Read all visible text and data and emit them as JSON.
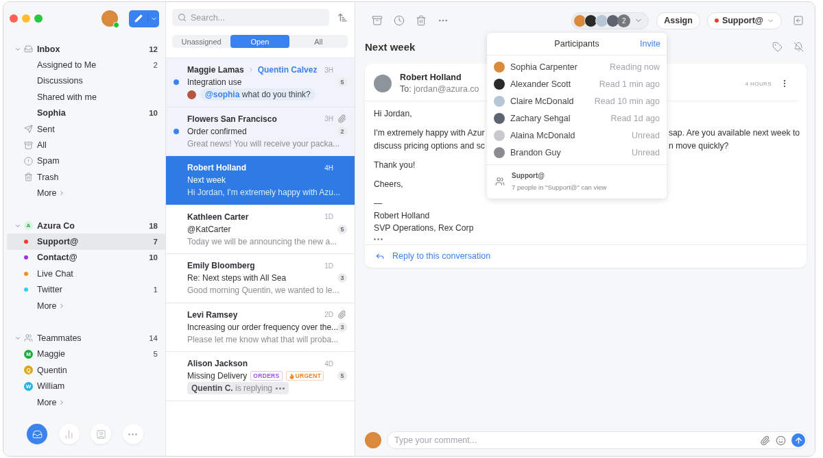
{
  "sidebar": {
    "user": {
      "online": true
    },
    "sections": [
      {
        "title": "Inbox",
        "count": "12",
        "expanded": true,
        "unread": true,
        "badge": {
          "kind": "inbox"
        },
        "items": [
          {
            "kind": "plain",
            "label": "Assigned to Me",
            "count": "2",
            "unread": false,
            "selected": false
          },
          {
            "kind": "plain",
            "label": "Discussions",
            "unread": false,
            "selected": false
          },
          {
            "kind": "plain",
            "label": "Shared with me",
            "unread": false,
            "selected": false
          },
          {
            "kind": "plain",
            "label": "Sophia",
            "count": "10",
            "unread": true,
            "selected": false
          },
          {
            "kind": "sent",
            "label": "Sent",
            "unread": false,
            "selected": false
          },
          {
            "kind": "archive",
            "label": "All",
            "unread": false,
            "selected": false
          },
          {
            "kind": "spam",
            "label": "Spam",
            "unread": false,
            "selected": false
          },
          {
            "kind": "trash",
            "label": "Trash",
            "unread": false,
            "selected": false
          },
          {
            "kind": "more",
            "label": "More",
            "unread": false,
            "selected": false
          }
        ]
      },
      {
        "title": "Azura Co",
        "count": "18",
        "expanded": true,
        "unread": true,
        "badge": {
          "kind": "letter",
          "letter": "A"
        },
        "items": [
          {
            "kind": "dot",
            "color": "#f23b2e",
            "label": "Support@",
            "count": "7",
            "unread": true,
            "selected": true
          },
          {
            "kind": "dot",
            "color": "#9b30f0",
            "label": "Contact@",
            "count": "10",
            "unread": true,
            "selected": false
          },
          {
            "kind": "dot",
            "color": "#fb8c1e",
            "label": "Live Chat",
            "unread": false,
            "selected": false
          },
          {
            "kind": "dot",
            "color": "#2ad0f5",
            "label": "Twitter",
            "count": "1",
            "unread": false,
            "selected": false
          },
          {
            "kind": "more",
            "label": "More",
            "unread": false,
            "selected": false
          }
        ]
      },
      {
        "title": "Teammates",
        "count": "14",
        "expanded": true,
        "unread": false,
        "badge": {
          "kind": "people"
        },
        "items": [
          {
            "kind": "letter",
            "letter": "M",
            "color": "#1eae3f",
            "label": "Maggie",
            "count": "5",
            "unread": false,
            "selected": false
          },
          {
            "kind": "letter",
            "letter": "Q",
            "color": "#dca818",
            "label": "Quentin",
            "unread": false,
            "selected": false
          },
          {
            "kind": "letter",
            "letter": "W",
            "color": "#22b2e4",
            "label": "William",
            "unread": false,
            "selected": false
          },
          {
            "kind": "more",
            "label": "More",
            "unread": false,
            "selected": false
          }
        ]
      }
    ],
    "nav": [
      {
        "kind": "inbox",
        "selected": true
      },
      {
        "kind": "analytics",
        "selected": false
      },
      {
        "kind": "contacts",
        "selected": false
      },
      {
        "kind": "more",
        "selected": false
      }
    ]
  },
  "list": {
    "search": {
      "placeholder": "Search..."
    },
    "tabs": [
      {
        "label": "Unassigned",
        "selected": false
      },
      {
        "label": "Open",
        "selected": true
      },
      {
        "label": "All",
        "selected": false
      }
    ],
    "conversations": [
      {
        "from": "Maggie Lamas",
        "assignee": "Quentin Calvez",
        "time": "3H",
        "subject": "Integration use",
        "count": "5",
        "unread": true,
        "selected": false,
        "attachment": false,
        "comment": {
          "mention": "@sophia",
          "text": "what do you think?"
        }
      },
      {
        "from": "Flowers San Francisco",
        "time": "3H",
        "subject": "Order confirmed",
        "preview": "Great news! You will receive your packa...",
        "count": "2",
        "unread": true,
        "selected": false,
        "attachment": true
      },
      {
        "from": "Robert Holland",
        "time": "4H",
        "subject": "Next week",
        "preview": "Hi Jordan, I'm extremely happy with Azu...",
        "unread": false,
        "selected": true,
        "attachment": false
      },
      {
        "from": "Kathleen Carter",
        "time": "1D",
        "subject": "@KatCarter",
        "preview": "Today we will be announcing the new a...",
        "count": "5",
        "unread": false,
        "selected": false,
        "attachment": false
      },
      {
        "from": "Emily Bloomberg",
        "time": "1D",
        "subject": "Re: Next steps with All Sea",
        "preview": "Good morning Quentin, we wanted to le...",
        "count": "3",
        "unread": false,
        "selected": false,
        "attachment": false
      },
      {
        "from": "Levi Ramsey",
        "time": "2D",
        "subject": "Increasing our order frequency over the...",
        "preview": "Please let me know what that will proba...",
        "count": "3",
        "unread": false,
        "selected": false,
        "attachment": true
      },
      {
        "from": "Alison Jackson",
        "time": "4D",
        "subject": "Missing Delivery",
        "count": "5",
        "unread": false,
        "selected": false,
        "attachment": false,
        "tags": [
          {
            "kind": "plain",
            "label": "ORDERS",
            "color": "#a24ff0"
          },
          {
            "kind": "fire",
            "label": "URGENT",
            "color": "#f5821f"
          }
        ],
        "typing": {
          "who": "Quentin C.",
          "text": "is replying"
        }
      }
    ]
  },
  "main": {
    "toolbar": {
      "participants_extra": "2",
      "assign": "Assign",
      "inbox": {
        "label": "Support@",
        "color": "#f23b2e"
      }
    },
    "title": "Next week",
    "message": {
      "sender": "Robert Holland",
      "to_label": "To:",
      "to": "jordan@azura.co",
      "time": "4 HOURS",
      "body": [
        {
          "kind": "text",
          "text": "Hi Jordan,"
        },
        {
          "kind": "split",
          "lines": [
            {
              "left": "I'm extremely happy with Azur",
              "right": "sap. Are you available next week to"
            },
            {
              "left": "discuss pricing options and sc",
              "right": "n move quickly?"
            }
          ]
        },
        {
          "kind": "text",
          "text": "Thank you!"
        },
        {
          "kind": "text",
          "text": "Cheers,"
        },
        {
          "kind": "signature",
          "lines": [
            "—",
            "Robert Holland",
            "SVP Operations, Rex Corp"
          ]
        },
        {
          "kind": "more"
        }
      ],
      "reply": "Reply to this conversation"
    },
    "composer": {
      "placeholder": "Type your comment..."
    },
    "popup": {
      "title": "Participants",
      "action": "Invite",
      "people": [
        {
          "name": "Sophia Carpenter",
          "status": "Reading now"
        },
        {
          "name": "Alexander Scott",
          "status": "Read 1 min ago"
        },
        {
          "name": "Claire McDonald",
          "status": "Read 10 min ago"
        },
        {
          "name": "Zachary Sehgal",
          "status": "Read 1d ago"
        },
        {
          "name": "Alaina McDonald",
          "status": "Unread"
        },
        {
          "name": "Brandon Guy",
          "status": "Unread"
        }
      ],
      "footer": {
        "title": "Support@",
        "text": "7 people in \"Support@\" can view"
      }
    }
  }
}
